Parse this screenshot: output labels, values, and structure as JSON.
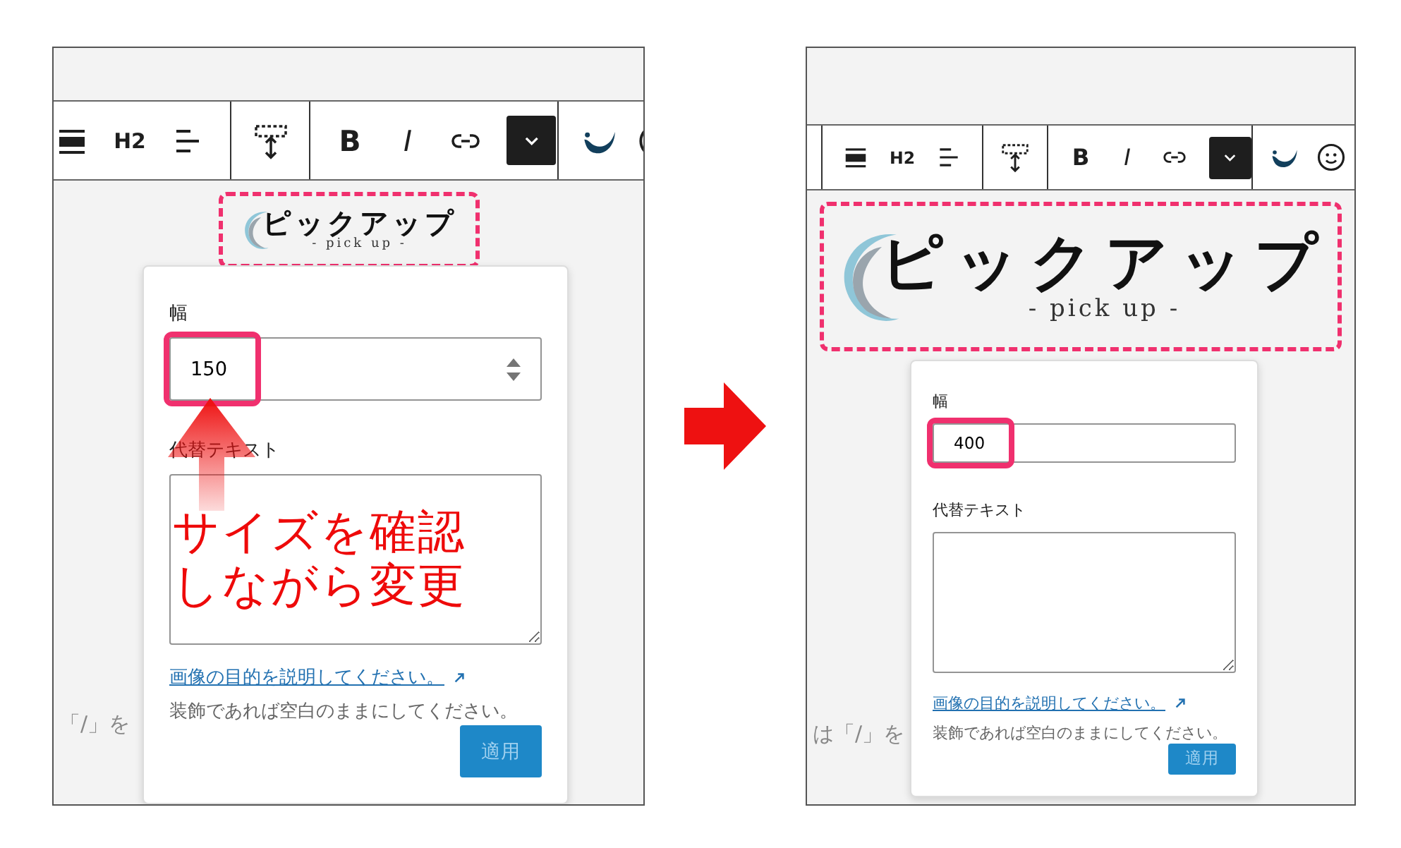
{
  "panels": [
    {
      "kind": "large",
      "toolbar": {
        "heading": "H2",
        "bold": "B",
        "italic": "I"
      },
      "logo": {
        "title": "ピックアップ",
        "subtitle": "- pick up -"
      },
      "hint_text": "「/」を",
      "popover": {
        "width_label": "幅",
        "width_value": "150",
        "stepper": true,
        "alt_label": "代替テキスト",
        "help_link": "画像の目的を説明してください。",
        "help_note": "装飾であれば空白のままにしてください。",
        "apply_button": "適用"
      },
      "annotation": {
        "lines": [
          "サイズを確認",
          "しながら変更"
        ]
      }
    },
    {
      "kind": "compact",
      "toolbar": {
        "heading": "H2",
        "bold": "B",
        "italic": "I"
      },
      "logo": {
        "title": "ピックアップ",
        "subtitle": "- pick up -"
      },
      "hint_text": "は「/」を",
      "popover": {
        "width_label": "幅",
        "width_value": "400",
        "stepper": false,
        "alt_label": "代替テキスト",
        "help_link": "画像の目的を説明してください。",
        "help_note": "装飾であれば空白のままにしてください。",
        "apply_button": "適用"
      }
    }
  ]
}
